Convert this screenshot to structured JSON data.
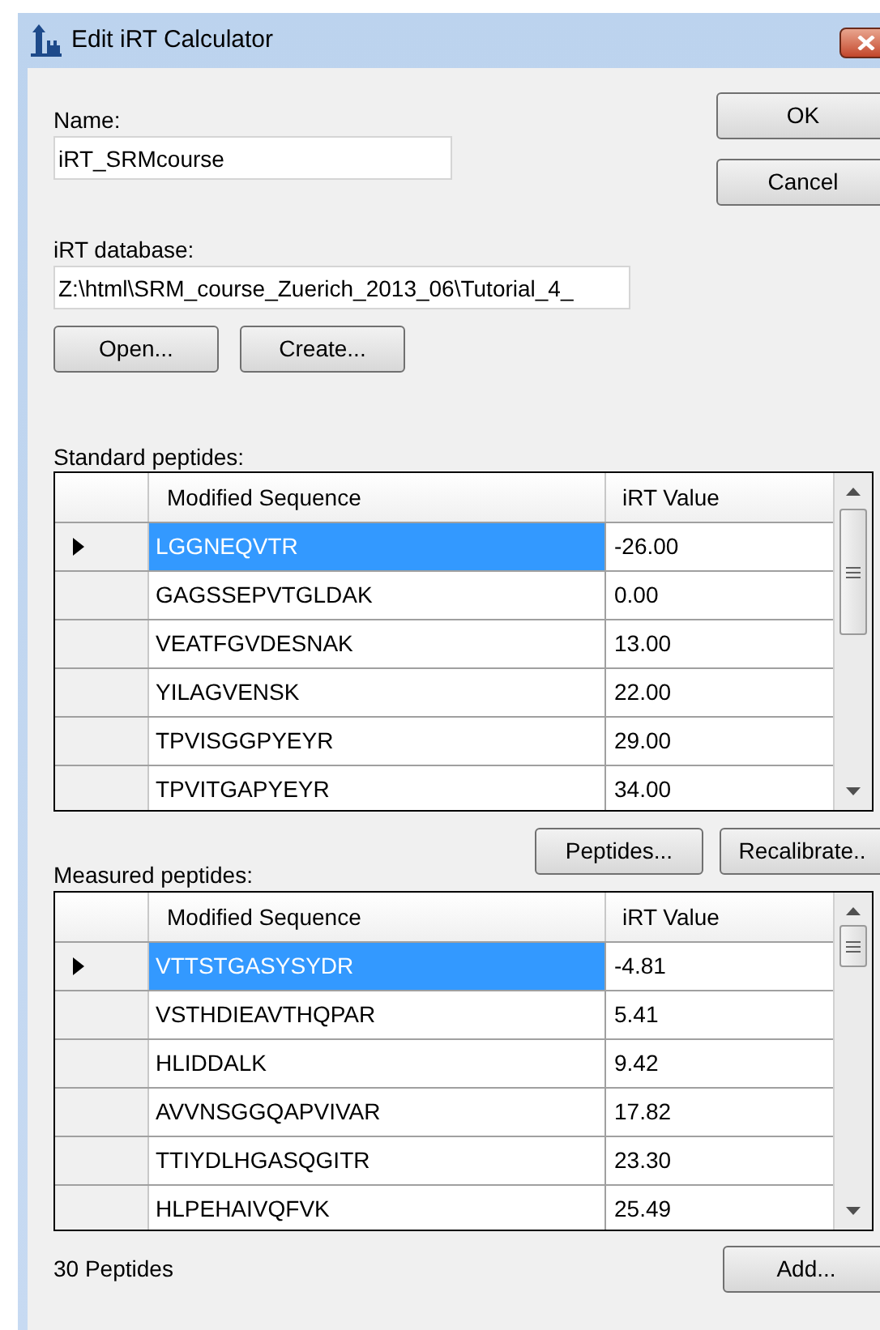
{
  "window": {
    "title": "Edit iRT Calculator"
  },
  "name_field": {
    "label": "Name:",
    "value": "iRT_SRMcourse"
  },
  "buttons": [
    "OK",
    "Cancel"
  ],
  "database_field": {
    "label": "iRT database:",
    "value": "Z:\\html\\SRM_course_Zuerich_2013_06\\Tutorial_4_"
  },
  "database_buttons": [
    "Open...",
    "Create..."
  ],
  "standard_peptides": {
    "label": "Standard peptides:",
    "columns": [
      "Modified Sequence",
      "iRT Value"
    ],
    "rows": [
      {
        "sequence": "LGGNEQVTR",
        "irt": "-26.00",
        "selected": true
      },
      {
        "sequence": "GAGSSEPVTGLDAK",
        "irt": "0.00",
        "selected": false
      },
      {
        "sequence": "VEATFGVDESNAK",
        "irt": "13.00",
        "selected": false
      },
      {
        "sequence": "YILAGVENSK",
        "irt": "22.00",
        "selected": false
      },
      {
        "sequence": "TPVISGGPYEYR",
        "irt": "29.00",
        "selected": false
      },
      {
        "sequence": "TPVITGAPYEYR",
        "irt": "34.00",
        "selected": false
      }
    ]
  },
  "standard_buttons": [
    "Peptides...",
    "Recalibrate.."
  ],
  "measured_peptides": {
    "label": "Measured peptides:",
    "columns": [
      "Modified Sequence",
      "iRT Value"
    ],
    "rows": [
      {
        "sequence": "VTTSTGASYSYDR",
        "irt": "-4.81",
        "selected": true
      },
      {
        "sequence": "VSTHDIEAVTHQPAR",
        "irt": "5.41",
        "selected": false
      },
      {
        "sequence": "HLIDDALK",
        "irt": "9.42",
        "selected": false
      },
      {
        "sequence": "AVVNSGGQAPVIVAR",
        "irt": "17.82",
        "selected": false
      },
      {
        "sequence": "TTIYDLHGASQGITR",
        "irt": "23.30",
        "selected": false
      },
      {
        "sequence": "HLPEHAIVQFVK",
        "irt": "25.49",
        "selected": false
      }
    ]
  },
  "status": "30 Peptides",
  "add_button": "Add..."
}
